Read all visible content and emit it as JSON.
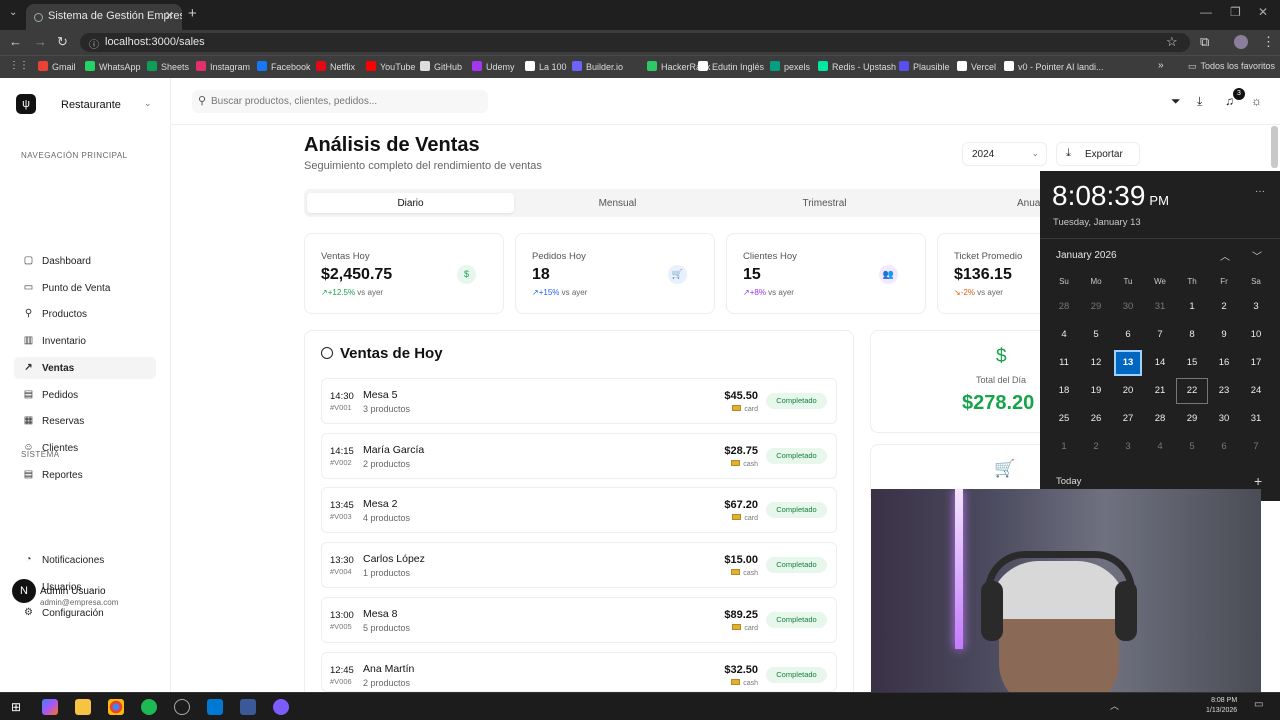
{
  "browser": {
    "tab_title": "Sistema de Gestión Empresarial",
    "url": "localhost:3000/sales",
    "bookmarks": [
      {
        "label": "Gmail",
        "color": "#ea4335"
      },
      {
        "label": "WhatsApp",
        "color": "#25d366"
      },
      {
        "label": "Sheets",
        "color": "#0f9d58"
      },
      {
        "label": "Instagram",
        "color": "#e1306c"
      },
      {
        "label": "Facebook",
        "color": "#1877f2"
      },
      {
        "label": "Netflix",
        "color": "#e50914"
      },
      {
        "label": "YouTube",
        "color": "#ff0000"
      },
      {
        "label": "GitHub",
        "color": "#dddddd"
      },
      {
        "label": "Udemy",
        "color": "#a435f0"
      },
      {
        "label": "La 100",
        "color": "#ffffff"
      },
      {
        "label": "Builder.io",
        "color": "#6c63ff"
      },
      {
        "label": "HackerRank",
        "color": "#2ec866"
      },
      {
        "label": "Edutin Inglés",
        "color": "#ffffff"
      },
      {
        "label": "pexels",
        "color": "#05a081"
      },
      {
        "label": "Redis - Upstash",
        "color": "#00e9a3"
      },
      {
        "label": "Plausible",
        "color": "#5850ec"
      },
      {
        "label": "Vercel",
        "color": "#ffffff"
      },
      {
        "label": "v0 - Pointer AI landi...",
        "color": "#ffffff"
      }
    ],
    "all_bookmarks": "Todos los favoritos"
  },
  "sidebar": {
    "brand": "Restaurante",
    "section_main": "NAVEGACIÓN PRINCIPAL",
    "main_items": [
      {
        "label": "Dashboard",
        "icon": "▢"
      },
      {
        "label": "Punto de Venta",
        "icon": "▭"
      },
      {
        "label": "Productos",
        "icon": "⚲"
      },
      {
        "label": "Inventario",
        "icon": "▥"
      },
      {
        "label": "Ventas",
        "icon": "↗"
      },
      {
        "label": "Pedidos",
        "icon": "▤"
      },
      {
        "label": "Reservas",
        "icon": "▦"
      },
      {
        "label": "Clientes",
        "icon": "☺"
      },
      {
        "label": "Reportes",
        "icon": "▤"
      }
    ],
    "section_system": "SISTEMA",
    "system_items": [
      {
        "label": "Notificaciones",
        "icon": "◔"
      },
      {
        "label": "Usuarios",
        "icon": "☺"
      },
      {
        "label": "Configuración",
        "icon": "⚙"
      }
    ],
    "user": {
      "initial": "N",
      "name": "Admin Usuario",
      "email": "admin@empresa.com"
    }
  },
  "topbar": {
    "search_placeholder": "Buscar productos, clientes, pedidos...",
    "notif_count": "3"
  },
  "page": {
    "title": "Análisis de Ventas",
    "subtitle": "Seguimiento completo del rendimiento de ventas",
    "year": "2024",
    "export_label": "Exportar",
    "tabs": [
      "Diario",
      "Mensual",
      "Trimestral",
      "Anual"
    ]
  },
  "kpis": [
    {
      "label": "Ventas Hoy",
      "value": "$2,450.75",
      "change": "+12.5%",
      "suffix": "vs ayer",
      "icon": "$",
      "color": "#16a34a",
      "bg": "#e8f7ee",
      "arrow": "↗"
    },
    {
      "label": "Pedidos Hoy",
      "value": "18",
      "change": "+15%",
      "suffix": "vs ayer",
      "icon": "🛒",
      "color": "#2563eb",
      "bg": "#e6f0ff",
      "arrow": "↗"
    },
    {
      "label": "Clientes Hoy",
      "value": "15",
      "change": "+8%",
      "suffix": "vs ayer",
      "icon": "👥",
      "color": "#9333ea",
      "bg": "#f3e8ff",
      "arrow": "↗"
    },
    {
      "label": "Ticket Promedio",
      "value": "$136.15",
      "change": "-2%",
      "suffix": "vs ayer",
      "icon": "↗",
      "color": "#ea580c",
      "bg": "#fff1e6",
      "arrow": "↘"
    }
  ],
  "sales": {
    "title": "Ventas de Hoy",
    "rows": [
      {
        "time": "14:30",
        "id": "#V001",
        "name": "Mesa 5",
        "items": "3 productos",
        "amount": "$45.50",
        "method": "card",
        "status": "Completado"
      },
      {
        "time": "14:15",
        "id": "#V002",
        "name": "María García",
        "items": "2 productos",
        "amount": "$28.75",
        "method": "cash",
        "status": "Completado"
      },
      {
        "time": "13:45",
        "id": "#V003",
        "name": "Mesa 2",
        "items": "4 productos",
        "amount": "$67.20",
        "method": "card",
        "status": "Completado"
      },
      {
        "time": "13:30",
        "id": "#V004",
        "name": "Carlos López",
        "items": "1 productos",
        "amount": "$15.00",
        "method": "cash",
        "status": "Completado"
      },
      {
        "time": "13:00",
        "id": "#V005",
        "name": "Mesa 8",
        "items": "5 productos",
        "amount": "$89.25",
        "method": "card",
        "status": "Completado"
      },
      {
        "time": "12:45",
        "id": "#V006",
        "name": "Ana Martín",
        "items": "2 productos",
        "amount": "$32.50",
        "method": "cash",
        "status": "Completado"
      }
    ]
  },
  "total": {
    "label": "Total del Día",
    "value": "$278.20"
  },
  "calendar": {
    "time": "8:08:39",
    "ampm": "PM",
    "date": "Tuesday, January 13",
    "month": "January 2026",
    "dow": [
      "Su",
      "Mo",
      "Tu",
      "We",
      "Th",
      "Fr",
      "Sa"
    ],
    "weeks": [
      [
        "28",
        "29",
        "30",
        "31",
        "1",
        "2",
        "3"
      ],
      [
        "4",
        "5",
        "6",
        "7",
        "8",
        "9",
        "10"
      ],
      [
        "11",
        "12",
        "13",
        "14",
        "15",
        "16",
        "17"
      ],
      [
        "18",
        "19",
        "20",
        "21",
        "22",
        "23",
        "24"
      ],
      [
        "25",
        "26",
        "27",
        "28",
        "29",
        "30",
        "31"
      ],
      [
        "1",
        "2",
        "3",
        "4",
        "5",
        "6",
        "7"
      ]
    ],
    "today_label": "Today"
  },
  "taskbar": {
    "time": "8:08 PM",
    "date": "1/13/2026"
  }
}
